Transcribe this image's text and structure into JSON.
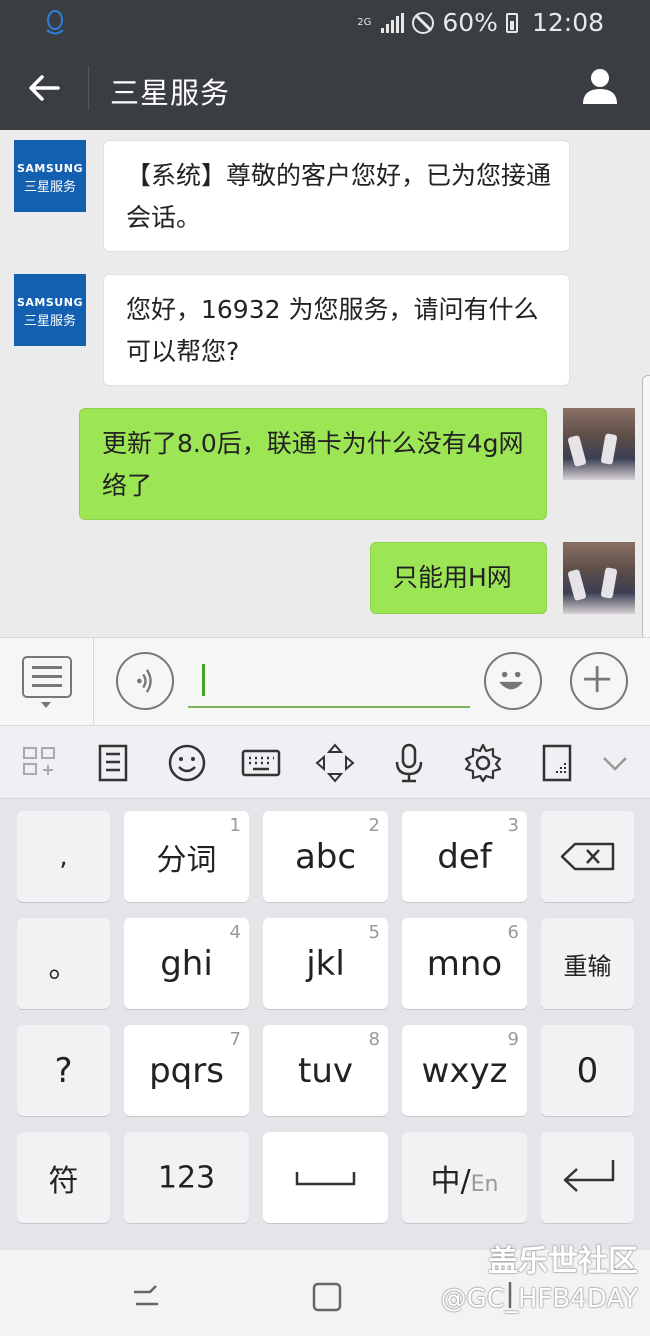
{
  "status_bar": {
    "network": "2G",
    "battery": "60%",
    "time": "12:08"
  },
  "header": {
    "title": "三星服务"
  },
  "avatar_text": {
    "brand": "SAMSUNG",
    "name": "三星服务"
  },
  "messages": [
    {
      "from": "agent",
      "text": "【系统】尊敬的客户您好，已为您接通会话。"
    },
    {
      "from": "agent",
      "text": "您好，16932 为您服务，请问有什么可以帮您?"
    },
    {
      "from": "user",
      "text": "更新了8.0后，联通卡为什么没有4g网络了"
    },
    {
      "from": "user",
      "text": "只能用H网"
    }
  ],
  "input": {
    "value": ""
  },
  "keyboard": {
    "left_col": [
      ",",
      "。",
      "?",
      "符"
    ],
    "rows": [
      [
        {
          "label": "分词",
          "num": "1"
        },
        {
          "label": "abc",
          "num": "2"
        },
        {
          "label": "def",
          "num": "3"
        }
      ],
      [
        {
          "label": "ghi",
          "num": "4"
        },
        {
          "label": "jkl",
          "num": "5"
        },
        {
          "label": "mno",
          "num": "6"
        }
      ],
      [
        {
          "label": "pqrs",
          "num": "7"
        },
        {
          "label": "tuv",
          "num": "8"
        },
        {
          "label": "wxyz",
          "num": "9"
        }
      ]
    ],
    "bottom": {
      "numbers": "123",
      "lang_cn": "中",
      "lang_sep": "/",
      "lang_en": "En"
    },
    "right_col": {
      "retype": "重输",
      "zero": "0"
    }
  },
  "watermark": {
    "site": "盖乐世社区",
    "user": "@GC_HFB4DAY"
  },
  "colors": {
    "header_bg": "#3a3d42",
    "user_bubble": "#9ce554",
    "samsung_blue": "#1460b0",
    "caret": "#45a32a"
  }
}
